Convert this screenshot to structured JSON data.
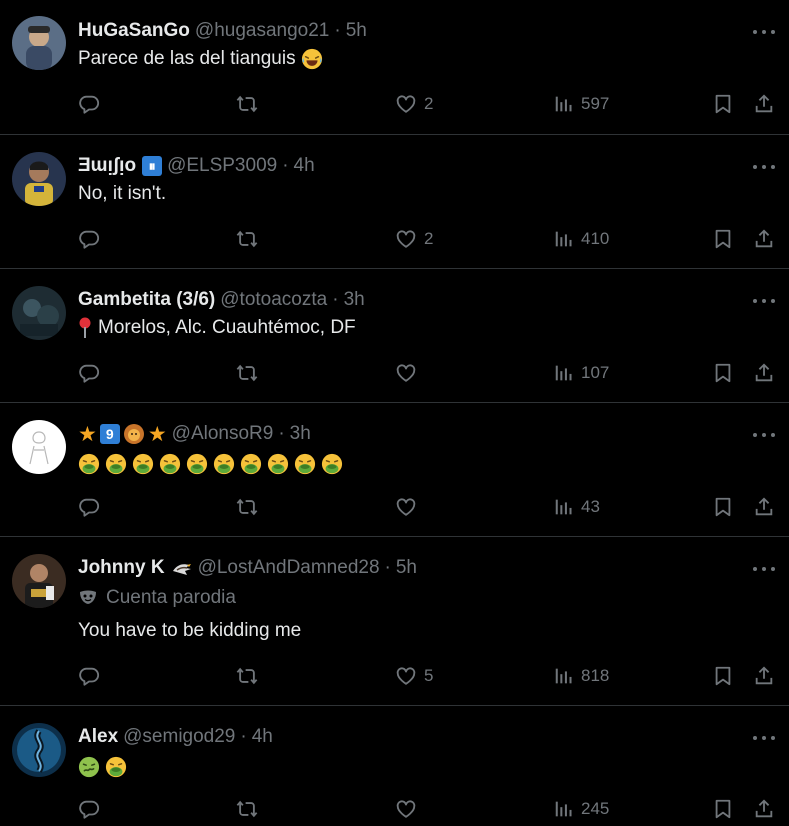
{
  "tweets": [
    {
      "name": "HuGaSanGo",
      "handle": "@hugasango21",
      "time": "5h",
      "text": "Parece de las del tianguis",
      "replies": "",
      "retweets": "",
      "likes": "2",
      "views": "597"
    },
    {
      "name": "Ǝɯᴉʃᴉo",
      "handle": "@ELSP3009",
      "time": "4h",
      "text": "No, it isn't.",
      "replies": "",
      "retweets": "",
      "likes": "2",
      "views": "410"
    },
    {
      "name": "Gambetita (3/6)",
      "handle": "@totoacozta",
      "time": "3h",
      "text": "Morelos, Alc. Cuauhtémoc, DF",
      "replies": "",
      "retweets": "",
      "likes": "",
      "views": "107"
    },
    {
      "name": "9",
      "handle": "@AlonsoR9",
      "time": "3h",
      "text": "",
      "replies": "",
      "retweets": "",
      "likes": "",
      "views": "43"
    },
    {
      "name": "Johnny K",
      "handle": "@LostAndDamned28",
      "time": "5h",
      "parody": "Cuenta parodia",
      "text": "You have to be kidding me",
      "replies": "",
      "retweets": "",
      "likes": "5",
      "views": "818"
    },
    {
      "name": "Alex",
      "handle": "@semigod29",
      "time": "4h",
      "text": "",
      "replies": "",
      "retweets": "",
      "likes": "",
      "views": "245"
    }
  ],
  "separator": "·",
  "colors": {
    "background": "#000000",
    "text": "#e7e9ea",
    "muted": "#71767b",
    "divider": "#2f3336"
  },
  "icons": [
    "reply-icon",
    "retweet-icon",
    "like-icon",
    "views-icon",
    "bookmark-icon",
    "share-icon",
    "more-icon"
  ]
}
